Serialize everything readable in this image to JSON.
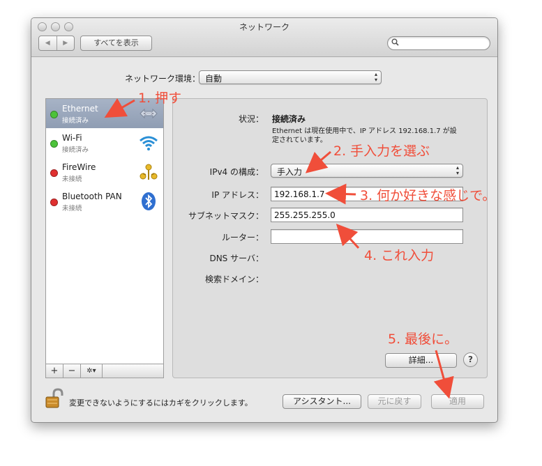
{
  "window": {
    "title": "ネットワーク",
    "back_glyph": "◀",
    "forward_glyph": "▶",
    "show_all_label": "すべてを表示",
    "search_placeholder": ""
  },
  "location": {
    "label": "ネットワーク環境：",
    "value": "自動"
  },
  "services": [
    {
      "name": "Ethernet",
      "status": "接続済み",
      "dot_color": "#4cc33a",
      "icon": "ethernet-icon"
    },
    {
      "name": "Wi-Fi",
      "status": "接続済み",
      "dot_color": "#4cc33a",
      "icon": "wifi-icon"
    },
    {
      "name": "FireWire",
      "status": "未接続",
      "dot_color": "#e03030",
      "icon": "firewire-icon"
    },
    {
      "name": "Bluetooth PAN",
      "status": "未接続",
      "dot_color": "#e03030",
      "icon": "bluetooth-icon"
    }
  ],
  "sidebar_footer": {
    "add": "+",
    "remove": "−",
    "gear": "✲▾"
  },
  "detail": {
    "status_label": "状況：",
    "status_value": "接続済み",
    "status_desc_line1": "Ethernet は現在使用中で、IP アドレス 192.168.1.7 が設",
    "status_desc_line2": "定されています。",
    "ipv4_label": "IPv4 の構成：",
    "ipv4_value": "手入力",
    "ip_label": "IP アドレス：",
    "ip_value": "192.168.1.7",
    "subnet_label": "サブネットマスク：",
    "subnet_value": "255.255.255.0",
    "router_label": "ルーター：",
    "router_value": "",
    "dns_label": "DNS サーバ：",
    "search_domain_label": "検索ドメイン：",
    "advanced_label": "詳細...",
    "help_label": "?"
  },
  "bottom": {
    "lock_message": "変更できないようにするにはカギをクリックします。",
    "assistant_label": "アシスタント...",
    "revert_label": "元に戻す",
    "apply_label": "適用"
  },
  "annotations": {
    "color": "#f04e3a",
    "step1": "1. 押す",
    "step2": "2. 手入力を選ぶ",
    "step3": "3. 何か好きな感じで。",
    "step4": "4. これ入力",
    "step5": "5. 最後に。"
  }
}
